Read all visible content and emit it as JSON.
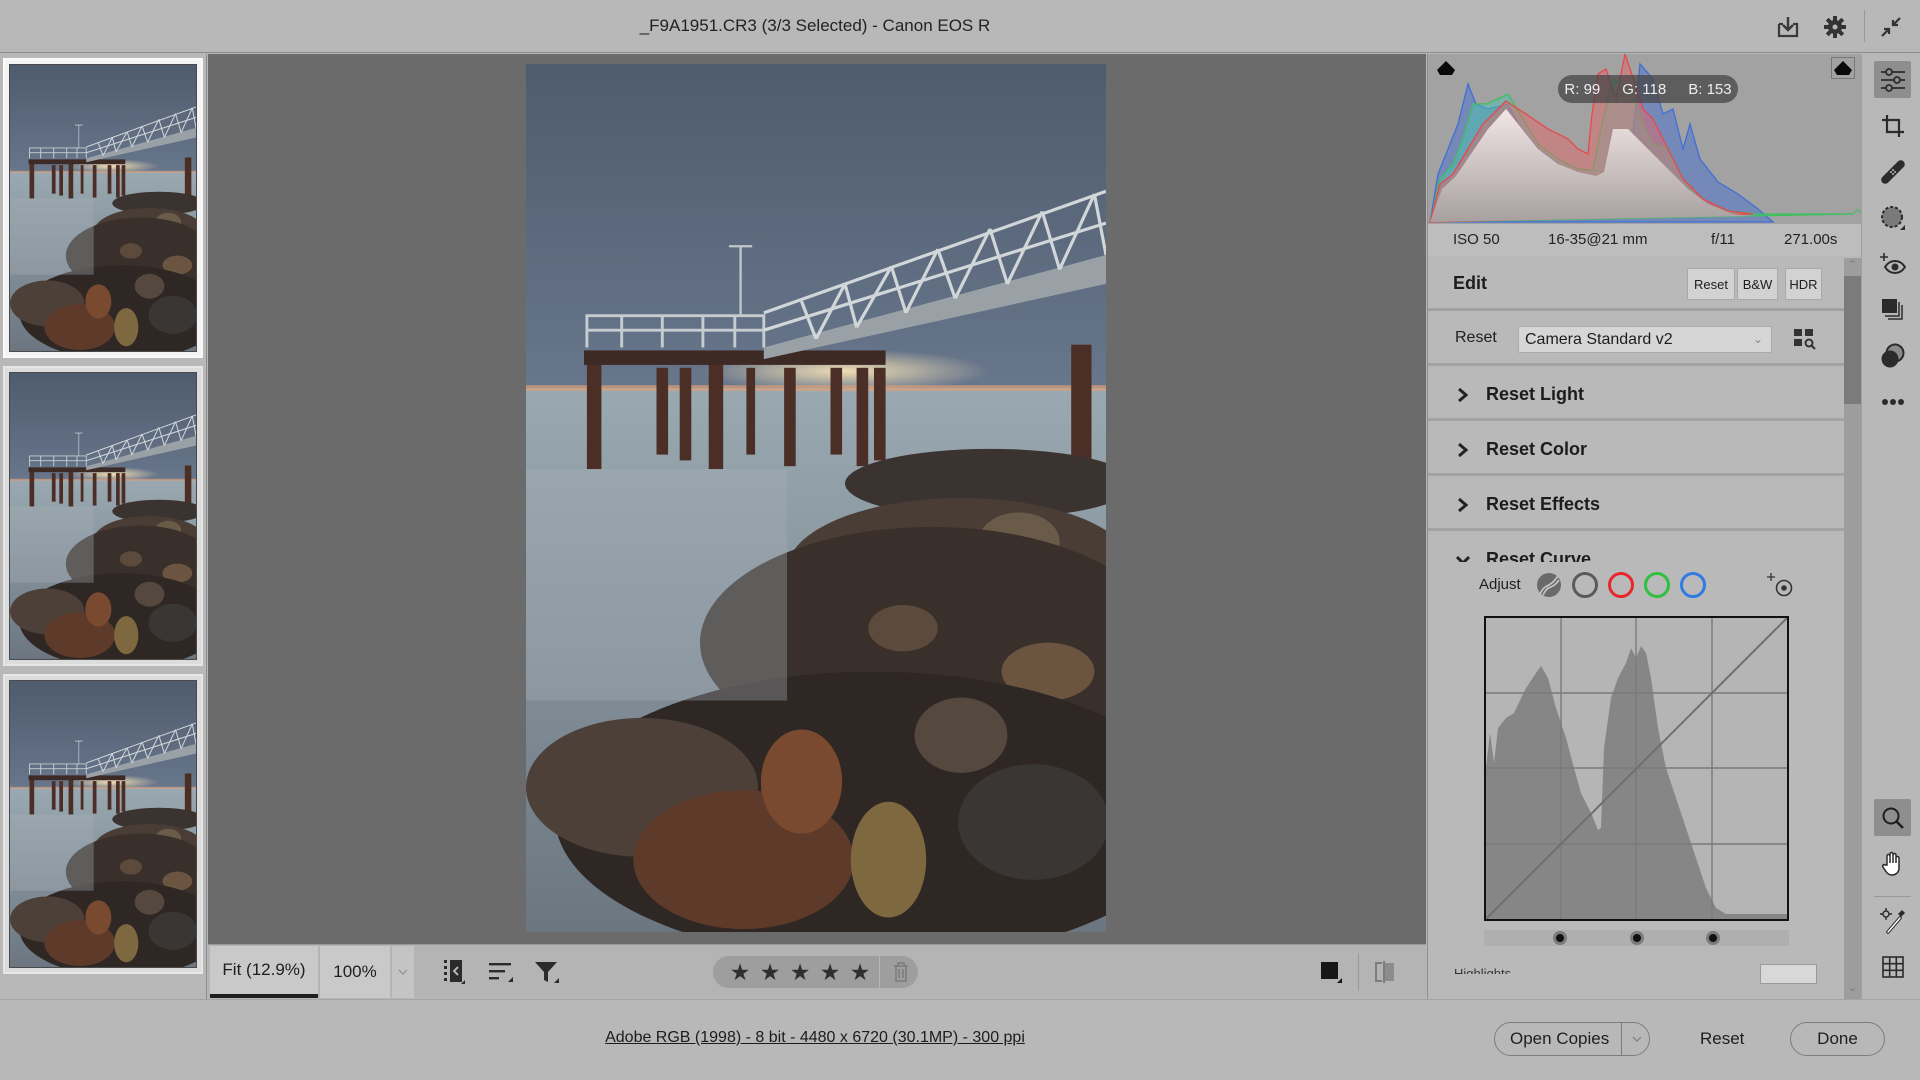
{
  "window": {
    "title": "_F9A1951.CR3 (3/3 Selected)  -  Canon EOS R",
    "icons": [
      "save-icon",
      "settings-gear-icon",
      "exit-fullscreen-icon"
    ]
  },
  "filmstrip": {
    "items": [
      {
        "name": "_F9A1951.CR3 thumbnail 1",
        "selected": true
      },
      {
        "name": "_F9A1951.CR3 thumbnail 2",
        "selected": true
      },
      {
        "name": "_F9A1951.CR3 thumbnail 3",
        "selected": true
      }
    ]
  },
  "bottombar": {
    "zoom_fit_label": "Fit (12.9%)",
    "zoom_100_label": "100%",
    "rating_stars": 5,
    "star_glyph": "★",
    "icons": [
      "filmstrip-toggle-icon",
      "sort-icon",
      "filter-icon",
      "trash-icon",
      "background-color-icon",
      "before-after-icon"
    ]
  },
  "histogram": {
    "readout": {
      "r_label": "R:",
      "r": "99",
      "g_label": "G:",
      "g": "118",
      "b_label": "B:",
      "b": "153"
    },
    "colors": {
      "red": "#e8484a",
      "green": "#3fbf5e",
      "blue": "#3f6fd8"
    }
  },
  "exif": {
    "iso": "ISO 50",
    "lens": "16-35@21 mm",
    "aperture": "f/11",
    "shutter": "271.00s"
  },
  "edit": {
    "heading": "Edit",
    "buttons": {
      "reset": "Reset",
      "bw": "B&W",
      "hdr": "HDR"
    },
    "profile_label": "Reset",
    "profile_value": "Camera Standard v2",
    "sections": [
      {
        "label": "Reset Light",
        "expanded": false
      },
      {
        "label": "Reset Color",
        "expanded": false
      },
      {
        "label": "Reset Effects",
        "expanded": false
      },
      {
        "label": "Reset Curve",
        "expanded": true
      }
    ],
    "curve": {
      "adjust_label": "Adjust",
      "channels": [
        "parametric",
        "rgb",
        "red",
        "green",
        "blue"
      ],
      "channel_colors": {
        "rgb": "#5a5a5a",
        "red": "#e8262b",
        "green": "#2fc03d",
        "blue": "#2f7be6"
      },
      "split_points": [
        0.25,
        0.5,
        0.75
      ],
      "next_label": "Highlights"
    }
  },
  "toolstrip": {
    "tools": [
      {
        "name": "edit-sliders",
        "active": true
      },
      {
        "name": "crop",
        "active": false
      },
      {
        "name": "healing",
        "active": false
      },
      {
        "name": "masking",
        "active": false
      },
      {
        "name": "red-eye",
        "active": false
      },
      {
        "name": "snapshots",
        "active": false
      },
      {
        "name": "presets",
        "active": false
      },
      {
        "name": "more",
        "active": false
      },
      {
        "name": "zoom",
        "active": true
      },
      {
        "name": "hand",
        "active": false
      },
      {
        "name": "color-sampler",
        "active": false
      },
      {
        "name": "grid",
        "active": false
      }
    ]
  },
  "footer": {
    "workflow_options": "Adobe RGB (1998) - 8 bit - 4480 x 6720 (30.1MP) - 300 ppi",
    "open_copies": "Open Copies",
    "reset": "Reset",
    "done": "Done"
  }
}
